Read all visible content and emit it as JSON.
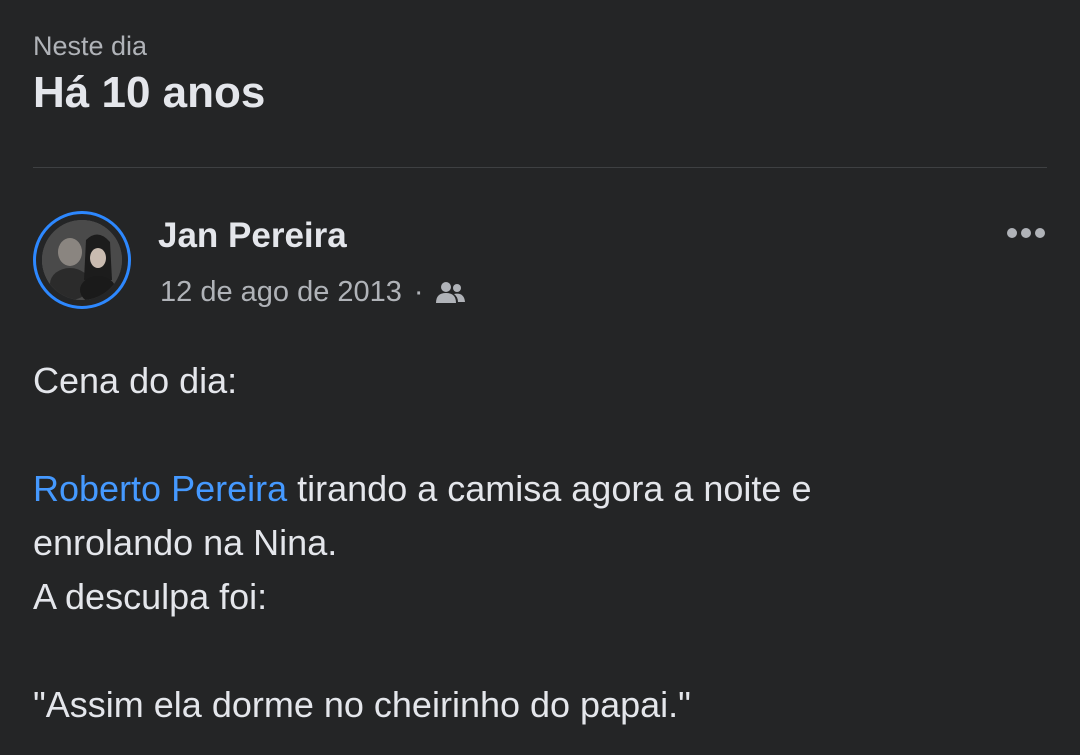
{
  "header": {
    "subtitle": "Neste dia",
    "title": "Há 10 anos"
  },
  "post": {
    "author": "Jan Pereira",
    "date": "12 de ago de 2013",
    "separator": "·",
    "audience_icon": "friends-icon",
    "more_icon": "more-options-icon",
    "body": {
      "line1": "Cena do dia:",
      "mention": "Roberto Pereira",
      "line2_rest": " tirando a camisa agora a noite e",
      "line3": "enrolando na Nina.",
      "line4": "A desculpa foi:",
      "line5": "\"Assim ela dorme no cheirinho do papai.\""
    }
  },
  "colors": {
    "background": "#242526",
    "text": "#e4e6eb",
    "secondary_text": "#b0b3b8",
    "mention": "#4599ff",
    "avatar_ring": "#2d88ff"
  }
}
